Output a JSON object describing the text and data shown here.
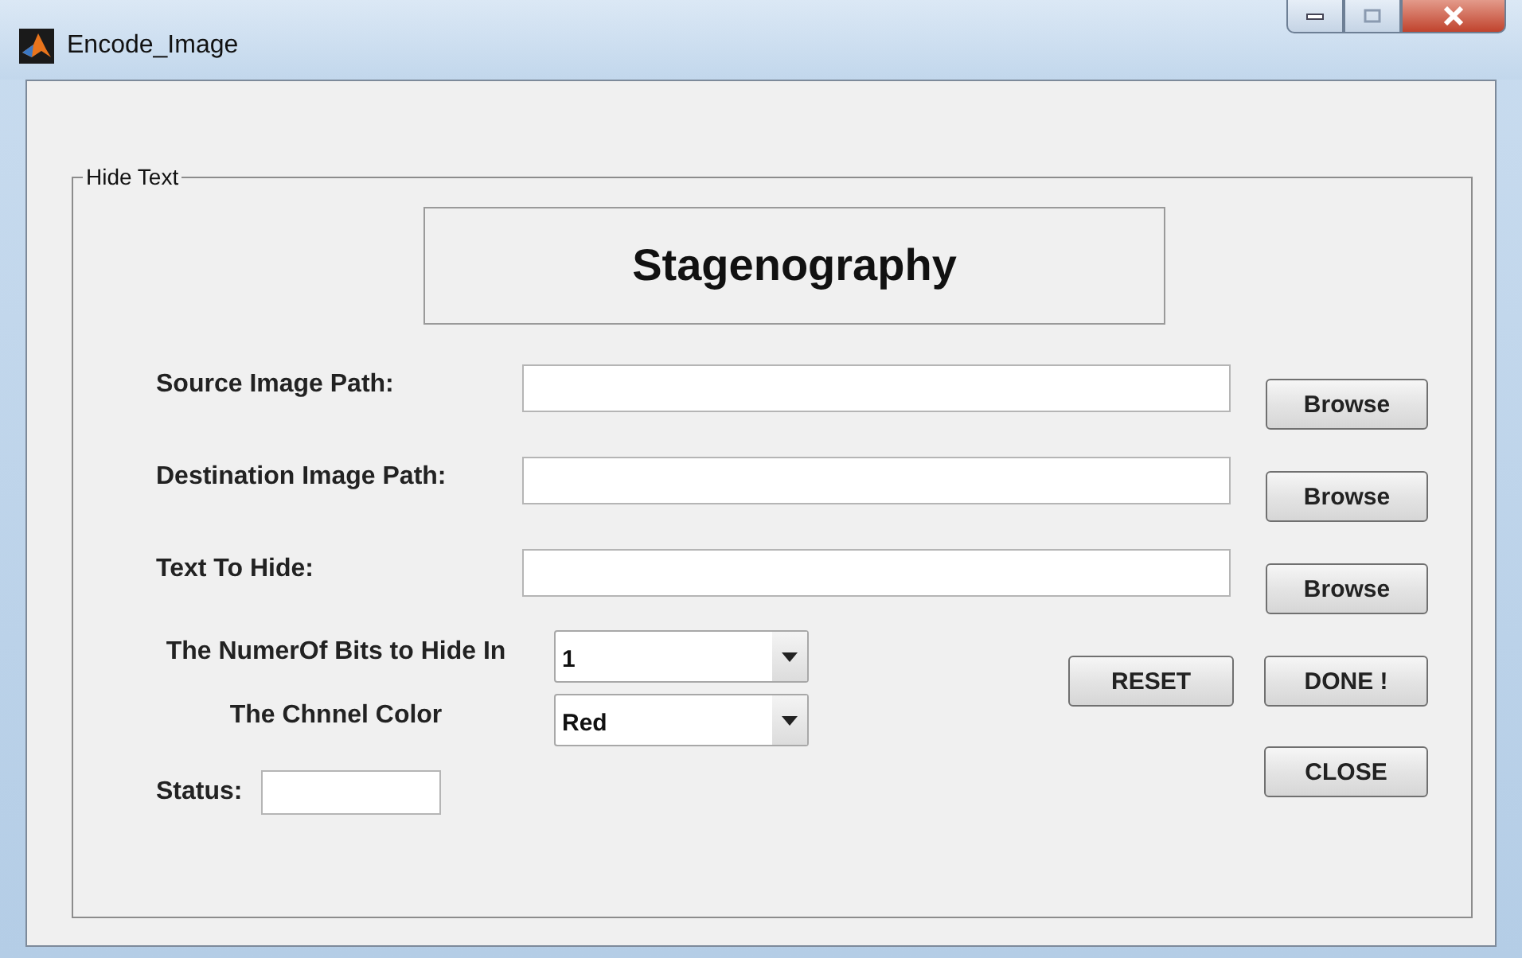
{
  "window": {
    "title": "Encode_Image"
  },
  "panel": {
    "legend": "Hide Text"
  },
  "heading": "Stagenography",
  "path_rows": [
    {
      "label": "Source Image Path:",
      "button": "Browse"
    },
    {
      "label": "Destination Image Path:",
      "button": "Browse"
    },
    {
      "label": "Text To Hide:",
      "button": "Browse"
    }
  ],
  "dropdowns": [
    {
      "label": "The NumerOf Bits to Hide In",
      "value": "1"
    },
    {
      "label": "The Chnnel Color",
      "value": "Red"
    }
  ],
  "action_buttons": [
    "RESET",
    "DONE !",
    "CLOSE"
  ],
  "status": {
    "label": "Status:"
  }
}
